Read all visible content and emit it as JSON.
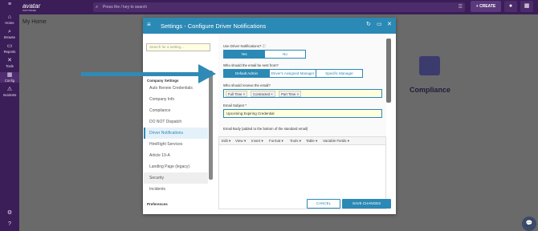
{
  "app": {
    "logo": "avatar",
    "logo_sub": "SOFTWARE",
    "search_placeholder": "Press the / key to search",
    "create_label": "CREATE"
  },
  "rail": [
    {
      "label": "Home",
      "icon": "home-icon",
      "glyph": "⌂"
    },
    {
      "label": "Browse",
      "icon": "folder-search-icon",
      "glyph": "⌕"
    },
    {
      "label": "Reports",
      "icon": "folder-icon",
      "glyph": "▭"
    },
    {
      "label": "Tools",
      "icon": "tools-icon",
      "glyph": "✕"
    },
    {
      "label": "Config",
      "icon": "config-icon",
      "glyph": "▦"
    },
    {
      "label": "Incidents",
      "icon": "incidents-icon",
      "glyph": "⚠"
    }
  ],
  "rail_bottom": {
    "settings": "⚙",
    "help": "?"
  },
  "page": {
    "title": "My Home",
    "bg_label": "Compliance"
  },
  "modal": {
    "title": "Settings - Configure Driver Notifications",
    "sidebar": {
      "search_placeholder": "Search for a setting...",
      "section_company": "Company Settings",
      "items": [
        "Auto Renew Credentials",
        "Company Info",
        "Compliance",
        "DO NOT Dispatch",
        "Driver Notifications",
        "HireRight Services",
        "Article 19-A",
        "Landing Page (legacy)",
        "Security",
        "Incidents"
      ],
      "active_item": "Driver Notifications",
      "section_preferences": "Preferences"
    },
    "form": {
      "use_notifications_label": "Use Driver Notifications?",
      "yes": "Yes",
      "no": "No",
      "sent_from_label": "Who should the email be sent from?",
      "from_options": [
        "Default Admin",
        "Driver's Assigned Manager",
        "Specific Manager"
      ],
      "from_selected": "Default Admin",
      "receive_label": "Who should receive the email?",
      "receive_tags": [
        "Full Time",
        "Contracted",
        "Part Time"
      ],
      "subject_label": "Email Subject *",
      "subject_value": "Upcoming Expiring Credential",
      "body_label": "Email Body (added to the bottom of the standard email)",
      "editor_menus": [
        "Edit",
        "View",
        "Insert",
        "Format",
        "Tools",
        "Table",
        "Variable Fields"
      ]
    },
    "buttons": {
      "cancel": "CANCEL",
      "save": "SAVE CHANGES"
    }
  },
  "colors": {
    "brand": "#3b1d58",
    "accent": "#2b89b5"
  }
}
